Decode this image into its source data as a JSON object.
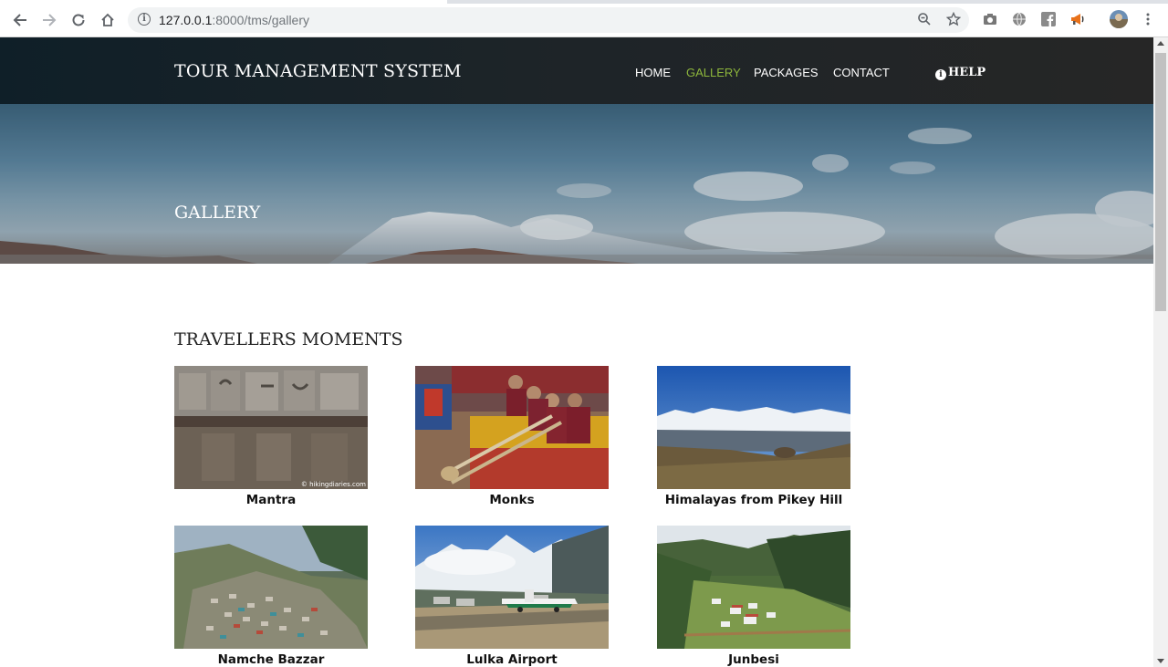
{
  "browser": {
    "url_host": "127.0.0.1",
    "url_rest": ":8000/tms/gallery"
  },
  "header": {
    "brand": "TOUR MANAGEMENT SYSTEM",
    "nav": {
      "home": "HOME",
      "gallery": "GALLERY",
      "packages": "PACKAGES",
      "contact": "CONTACT",
      "help": "HELP"
    },
    "active_color": "#8db53c"
  },
  "banner": {
    "title": "GALLERY"
  },
  "gallery": {
    "title": "TRAVELLERS MOMENTS",
    "items": [
      {
        "caption": "Mantra",
        "watermark": "© hikingdiaries.com"
      },
      {
        "caption": "Monks"
      },
      {
        "caption": "Himalayas from Pikey Hill"
      },
      {
        "caption": "Namche Bazzar"
      },
      {
        "caption": "Lulka Airport"
      },
      {
        "caption": "Junbesi"
      }
    ]
  }
}
